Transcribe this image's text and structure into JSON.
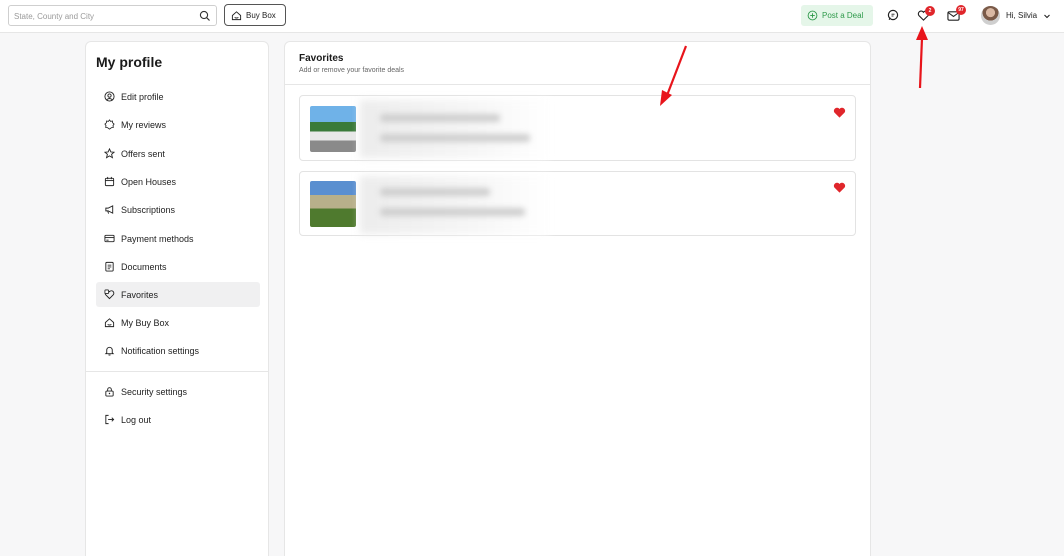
{
  "header": {
    "search_placeholder": "State, County and City",
    "buybox_label": "Buy Box",
    "post_deal_label": "Post a Deal",
    "favorites_badge": "2",
    "messages_badge": "97",
    "greeting": "Hi, Silvia"
  },
  "sidebar": {
    "title": "My profile",
    "items": [
      {
        "label": "Edit profile",
        "icon": "user-circle-icon"
      },
      {
        "label": "My reviews",
        "icon": "star-badge-icon"
      },
      {
        "label": "Offers sent",
        "icon": "star-icon"
      },
      {
        "label": "Open Houses",
        "icon": "calendar-icon"
      },
      {
        "label": "Subscriptions",
        "icon": "megaphone-icon"
      },
      {
        "label": "Payment methods",
        "icon": "credit-card-icon"
      },
      {
        "label": "Documents",
        "icon": "document-icon"
      },
      {
        "label": "Favorites",
        "icon": "favorites-icon"
      },
      {
        "label": "My Buy Box",
        "icon": "buybox-icon"
      },
      {
        "label": "Notification settings",
        "icon": "bell-icon"
      },
      {
        "label": "Security settings",
        "icon": "lock-icon"
      },
      {
        "label": "Log out",
        "icon": "logout-icon"
      }
    ],
    "active": "Favorites"
  },
  "main": {
    "title": "Favorites",
    "subtitle": "Add or remove your favorite deals",
    "deals": [
      {
        "favorited": true
      },
      {
        "favorited": true
      }
    ]
  },
  "colors": {
    "accent_green": "#2f9a4b",
    "badge_red": "#e0262b",
    "heart_red": "#e0262b",
    "annotation_arrow": "#e8141b"
  }
}
